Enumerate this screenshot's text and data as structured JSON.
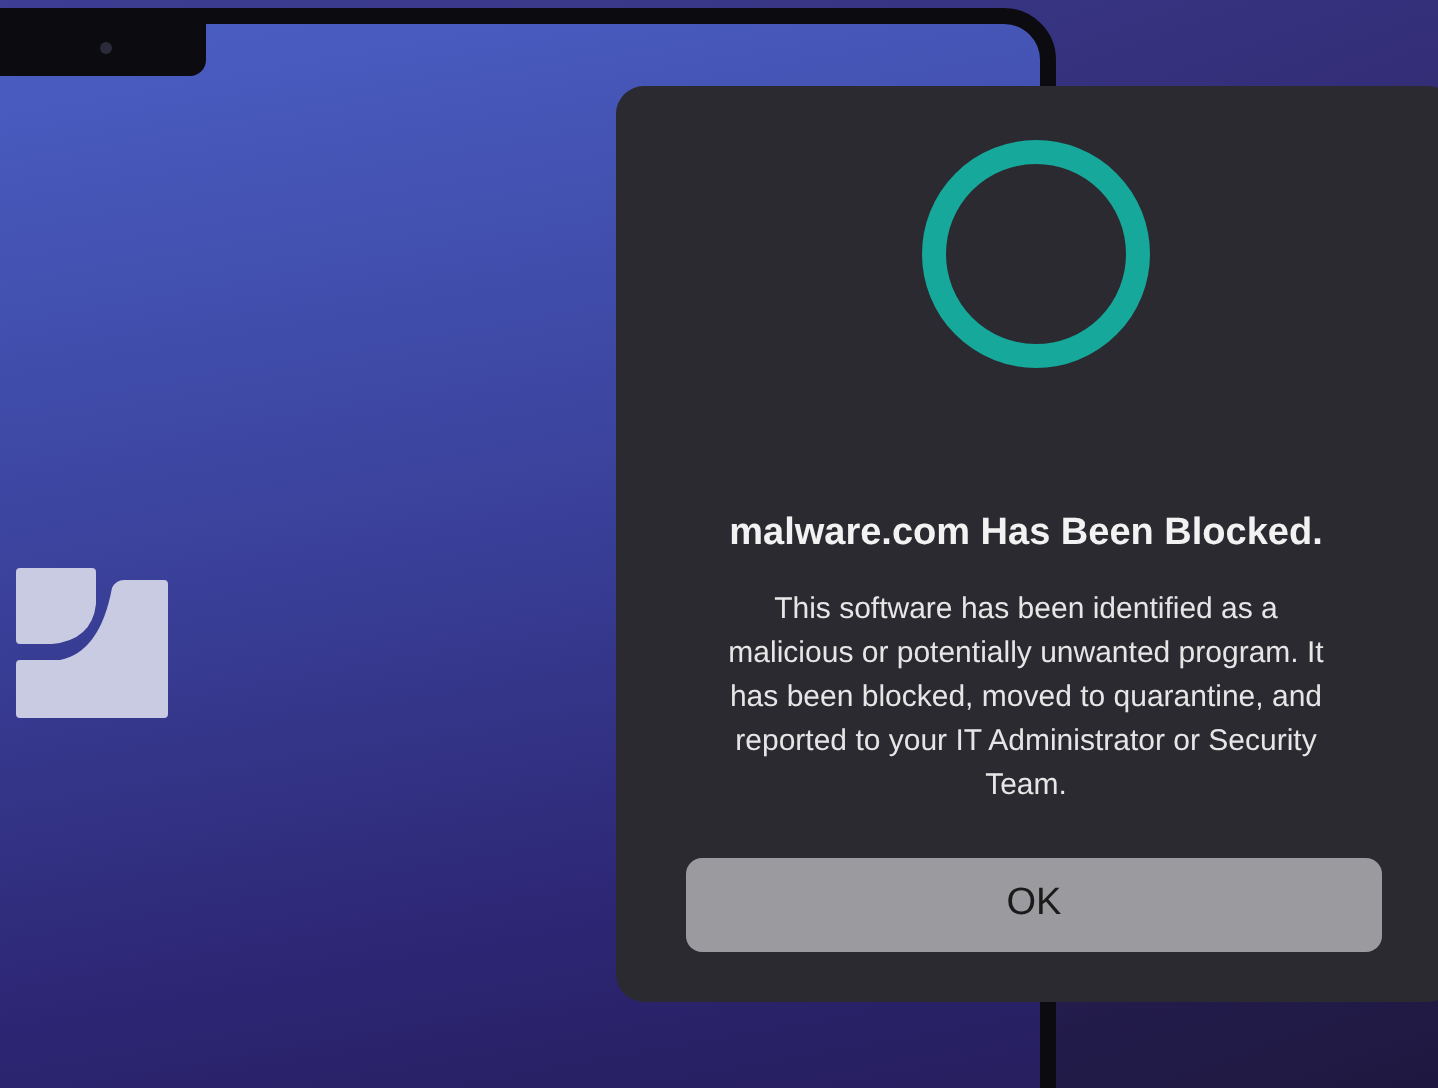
{
  "dialog": {
    "title": "malware.com Has Been Blocked.",
    "message": "This software has been identified as a malicious or potentially unwanted program. It has been blocked, moved to quarantine, and reported to your IT Administrator or Security Team.",
    "buttons": [
      {
        "label": "OK"
      }
    ]
  }
}
